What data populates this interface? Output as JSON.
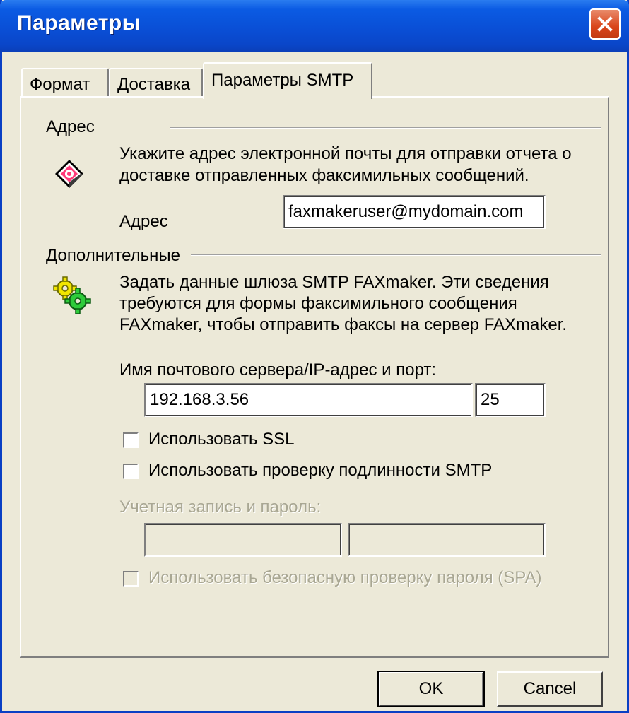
{
  "window": {
    "title": "Параметры"
  },
  "tabs": [
    {
      "label": "Формат",
      "active": false
    },
    {
      "label": "Доставка",
      "active": false
    },
    {
      "label": "Параметры SMTP",
      "active": true
    }
  ],
  "address_section": {
    "heading": "Адрес",
    "description_line1": "Укажите адрес электронной почты для отправки отчета о",
    "description_line2": "доставке отправленных факсимильных сообщений.",
    "field_label": "Адрес",
    "field_value": "faxmakeruser@mydomain.com",
    "icon": "mail-report-icon"
  },
  "advanced_section": {
    "heading": "Дополнительные",
    "description_line1": "Задать данные шлюза SMTP FAXmaker. Эти сведения",
    "description_line2": "требуются для формы факсимильного сообщения",
    "description_line3": "FAXmaker, чтобы отправить факсы на сервер FAXmaker.",
    "icon": "gears-icon",
    "server_label": "Имя почтового сервера/IP-адрес и порт:",
    "server_value": "192.168.3.56",
    "port_value": "25",
    "ssl_label": "Использовать SSL",
    "ssl_checked": false,
    "auth_label": "Использовать проверку подлинности SMTP",
    "auth_checked": false,
    "account_label": "Учетная запись и пароль:",
    "account_value": "",
    "password_value": "",
    "spa_label": "Использовать безопасную проверку пароля (SPA)",
    "spa_checked": false
  },
  "buttons": {
    "ok": "OK",
    "cancel": "Cancel"
  }
}
